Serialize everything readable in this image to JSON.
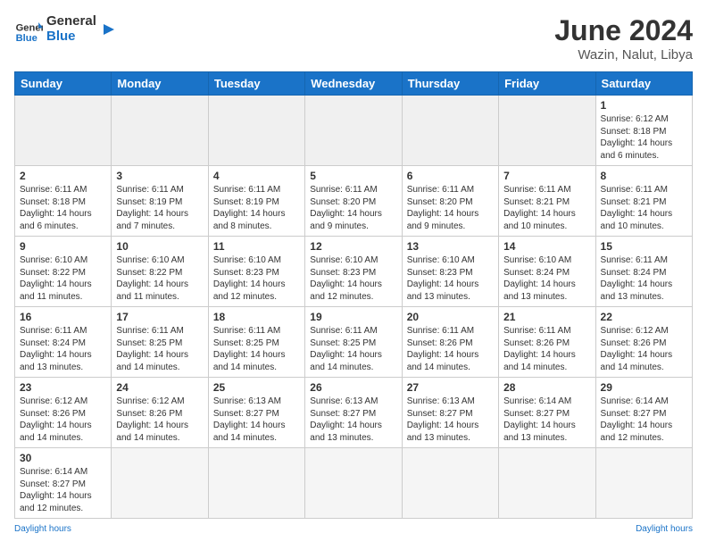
{
  "header": {
    "logo_general": "General",
    "logo_blue": "Blue",
    "month_title": "June 2024",
    "location": "Wazin, Nalut, Libya"
  },
  "weekdays": [
    "Sunday",
    "Monday",
    "Tuesday",
    "Wednesday",
    "Thursday",
    "Friday",
    "Saturday"
  ],
  "weeks": [
    [
      {
        "day": "",
        "empty": true
      },
      {
        "day": "",
        "empty": true
      },
      {
        "day": "",
        "empty": true
      },
      {
        "day": "",
        "empty": true
      },
      {
        "day": "",
        "empty": true
      },
      {
        "day": "",
        "empty": true
      },
      {
        "day": "1",
        "sunrise": "6:12 AM",
        "sunset": "8:18 PM",
        "daylight": "14 hours and 6 minutes."
      }
    ],
    [
      {
        "day": "2",
        "sunrise": "6:11 AM",
        "sunset": "8:18 PM",
        "daylight": "14 hours and 6 minutes."
      },
      {
        "day": "3",
        "sunrise": "6:11 AM",
        "sunset": "8:19 PM",
        "daylight": "14 hours and 7 minutes."
      },
      {
        "day": "4",
        "sunrise": "6:11 AM",
        "sunset": "8:19 PM",
        "daylight": "14 hours and 8 minutes."
      },
      {
        "day": "5",
        "sunrise": "6:11 AM",
        "sunset": "8:20 PM",
        "daylight": "14 hours and 9 minutes."
      },
      {
        "day": "6",
        "sunrise": "6:11 AM",
        "sunset": "8:20 PM",
        "daylight": "14 hours and 9 minutes."
      },
      {
        "day": "7",
        "sunrise": "6:11 AM",
        "sunset": "8:21 PM",
        "daylight": "14 hours and 10 minutes."
      },
      {
        "day": "8",
        "sunrise": "6:11 AM",
        "sunset": "8:21 PM",
        "daylight": "14 hours and 10 minutes."
      }
    ],
    [
      {
        "day": "9",
        "sunrise": "6:10 AM",
        "sunset": "8:22 PM",
        "daylight": "14 hours and 11 minutes."
      },
      {
        "day": "10",
        "sunrise": "6:10 AM",
        "sunset": "8:22 PM",
        "daylight": "14 hours and 11 minutes."
      },
      {
        "day": "11",
        "sunrise": "6:10 AM",
        "sunset": "8:23 PM",
        "daylight": "14 hours and 12 minutes."
      },
      {
        "day": "12",
        "sunrise": "6:10 AM",
        "sunset": "8:23 PM",
        "daylight": "14 hours and 12 minutes."
      },
      {
        "day": "13",
        "sunrise": "6:10 AM",
        "sunset": "8:23 PM",
        "daylight": "14 hours and 13 minutes."
      },
      {
        "day": "14",
        "sunrise": "6:10 AM",
        "sunset": "8:24 PM",
        "daylight": "14 hours and 13 minutes."
      },
      {
        "day": "15",
        "sunrise": "6:11 AM",
        "sunset": "8:24 PM",
        "daylight": "14 hours and 13 minutes."
      }
    ],
    [
      {
        "day": "16",
        "sunrise": "6:11 AM",
        "sunset": "8:24 PM",
        "daylight": "14 hours and 13 minutes."
      },
      {
        "day": "17",
        "sunrise": "6:11 AM",
        "sunset": "8:25 PM",
        "daylight": "14 hours and 14 minutes."
      },
      {
        "day": "18",
        "sunrise": "6:11 AM",
        "sunset": "8:25 PM",
        "daylight": "14 hours and 14 minutes."
      },
      {
        "day": "19",
        "sunrise": "6:11 AM",
        "sunset": "8:25 PM",
        "daylight": "14 hours and 14 minutes."
      },
      {
        "day": "20",
        "sunrise": "6:11 AM",
        "sunset": "8:26 PM",
        "daylight": "14 hours and 14 minutes."
      },
      {
        "day": "21",
        "sunrise": "6:11 AM",
        "sunset": "8:26 PM",
        "daylight": "14 hours and 14 minutes."
      },
      {
        "day": "22",
        "sunrise": "6:12 AM",
        "sunset": "8:26 PM",
        "daylight": "14 hours and 14 minutes."
      }
    ],
    [
      {
        "day": "23",
        "sunrise": "6:12 AM",
        "sunset": "8:26 PM",
        "daylight": "14 hours and 14 minutes."
      },
      {
        "day": "24",
        "sunrise": "6:12 AM",
        "sunset": "8:26 PM",
        "daylight": "14 hours and 14 minutes."
      },
      {
        "day": "25",
        "sunrise": "6:13 AM",
        "sunset": "8:27 PM",
        "daylight": "14 hours and 14 minutes."
      },
      {
        "day": "26",
        "sunrise": "6:13 AM",
        "sunset": "8:27 PM",
        "daylight": "14 hours and 13 minutes."
      },
      {
        "day": "27",
        "sunrise": "6:13 AM",
        "sunset": "8:27 PM",
        "daylight": "14 hours and 13 minutes."
      },
      {
        "day": "28",
        "sunrise": "6:14 AM",
        "sunset": "8:27 PM",
        "daylight": "14 hours and 13 minutes."
      },
      {
        "day": "29",
        "sunrise": "6:14 AM",
        "sunset": "8:27 PM",
        "daylight": "14 hours and 12 minutes."
      }
    ],
    [
      {
        "day": "30",
        "sunrise": "6:14 AM",
        "sunset": "8:27 PM",
        "daylight": "14 hours and 12 minutes."
      },
      {
        "day": "",
        "empty": true
      },
      {
        "day": "",
        "empty": true
      },
      {
        "day": "",
        "empty": true
      },
      {
        "day": "",
        "empty": true
      },
      {
        "day": "",
        "empty": true
      },
      {
        "day": "",
        "empty": true
      }
    ]
  ],
  "footer": {
    "left_label": "Daylight hours",
    "right_label": "Daylight hours",
    "left_url": "https://www.generalblue.com/",
    "right_url": "https://www.generalblue.com/"
  }
}
